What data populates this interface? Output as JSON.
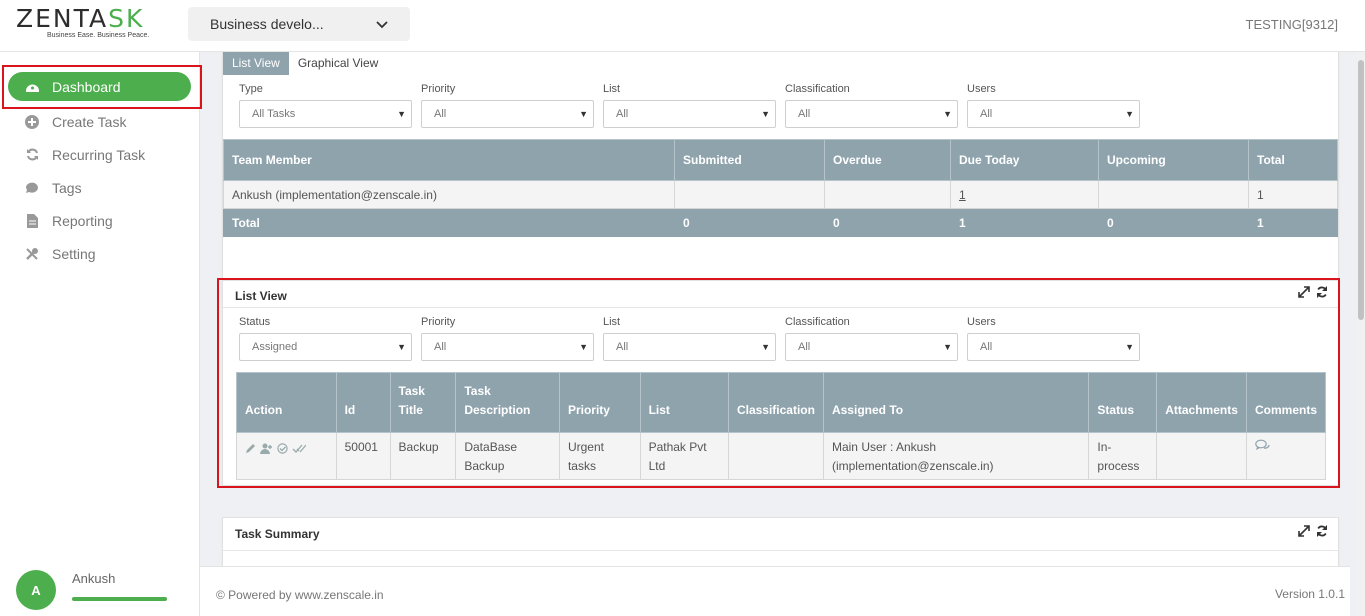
{
  "brand": {
    "logo_main": "ZENT",
    "logo_mid": "A",
    "logo_end": "SK",
    "tagline": "Business Ease. Business Peace."
  },
  "header": {
    "project_select": "Business develo...",
    "org": "TESTING[9312]"
  },
  "sidebar": {
    "items": [
      {
        "label": "Dashboard",
        "icon": "dashboard-icon"
      },
      {
        "label": "Create Task",
        "icon": "plus-circle-icon"
      },
      {
        "label": "Recurring Task",
        "icon": "refresh-icon"
      },
      {
        "label": "Tags",
        "icon": "tags-icon"
      },
      {
        "label": "Reporting",
        "icon": "file-icon"
      },
      {
        "label": "Setting",
        "icon": "tools-icon"
      }
    ],
    "user": {
      "initial": "A",
      "name": "Ankush"
    }
  },
  "summary": {
    "tabs": [
      "List View",
      "Graphical View"
    ],
    "filters": [
      {
        "label": "Type",
        "value": "All Tasks"
      },
      {
        "label": "Priority",
        "value": "All"
      },
      {
        "label": "List",
        "value": "All"
      },
      {
        "label": "Classification",
        "value": "All"
      },
      {
        "label": "Users",
        "value": "All"
      }
    ],
    "columns": [
      "Team Member",
      "Submitted",
      "Overdue",
      "Due Today",
      "Upcoming",
      "Total"
    ],
    "rows": [
      [
        "Ankush (implementation@zenscale.in)",
        "",
        "",
        "1",
        "",
        "1"
      ]
    ],
    "total": [
      "Total",
      "0",
      "0",
      "1",
      "0",
      "1"
    ]
  },
  "list_view": {
    "title": "List View",
    "filters": [
      {
        "label": "Status",
        "value": "Assigned"
      },
      {
        "label": "Priority",
        "value": "All"
      },
      {
        "label": "List",
        "value": "All"
      },
      {
        "label": "Classification",
        "value": "All"
      },
      {
        "label": "Users",
        "value": "All"
      }
    ],
    "columns": [
      "Action",
      "Id",
      "Task Title",
      "Task Description",
      "Priority",
      "List",
      "Classification",
      "Assigned To",
      "Status",
      "Attachments",
      "Comments"
    ],
    "rows": [
      {
        "id": "50001",
        "title": "Backup",
        "description": "DataBase Backup",
        "priority": "Urgent tasks",
        "list": "Pathak Pvt Ltd",
        "classification": "",
        "assigned_to": "Main User : Ankush (implementation@zenscale.in)",
        "status": "In-process",
        "attachments": ""
      }
    ]
  },
  "task_summary": {
    "title": "Task Summary"
  },
  "footer": {
    "left": "© Powered by www.zenscale.in",
    "right": "Version 1.0.1"
  },
  "colors": {
    "accent": "#4cae4c",
    "table_header": "#8fa3ad",
    "highlight": "#d9141c"
  }
}
